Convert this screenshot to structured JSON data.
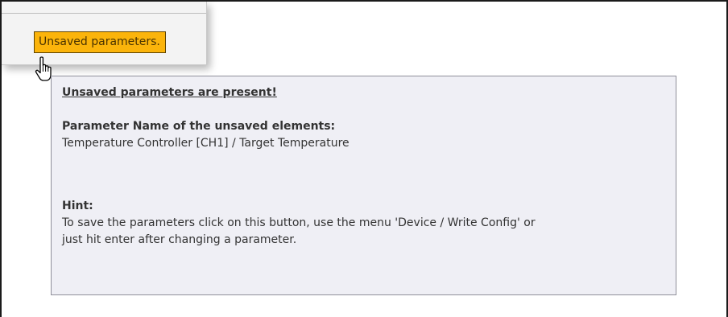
{
  "status": {
    "badge_label": "Unsaved parameters."
  },
  "tooltip": {
    "title": "Unsaved parameters are present!",
    "unsaved_label": "Parameter Name of the unsaved elements:",
    "unsaved_value": "Temperature Controller [CH1] / Target Temperature",
    "hint_label": "Hint:",
    "hint_line_1": "To save the parameters click on this button, use the menu 'Device / Write Config' or",
    "hint_line_2": "just hit enter after changing a parameter."
  },
  "colors": {
    "badge_background": "#fbb40b",
    "badge_border": "#5f4400",
    "tooltip_background": "#efeff5",
    "tooltip_border": "#8f8f9a"
  },
  "icons": {
    "cursor": "hand-pointer-icon"
  }
}
